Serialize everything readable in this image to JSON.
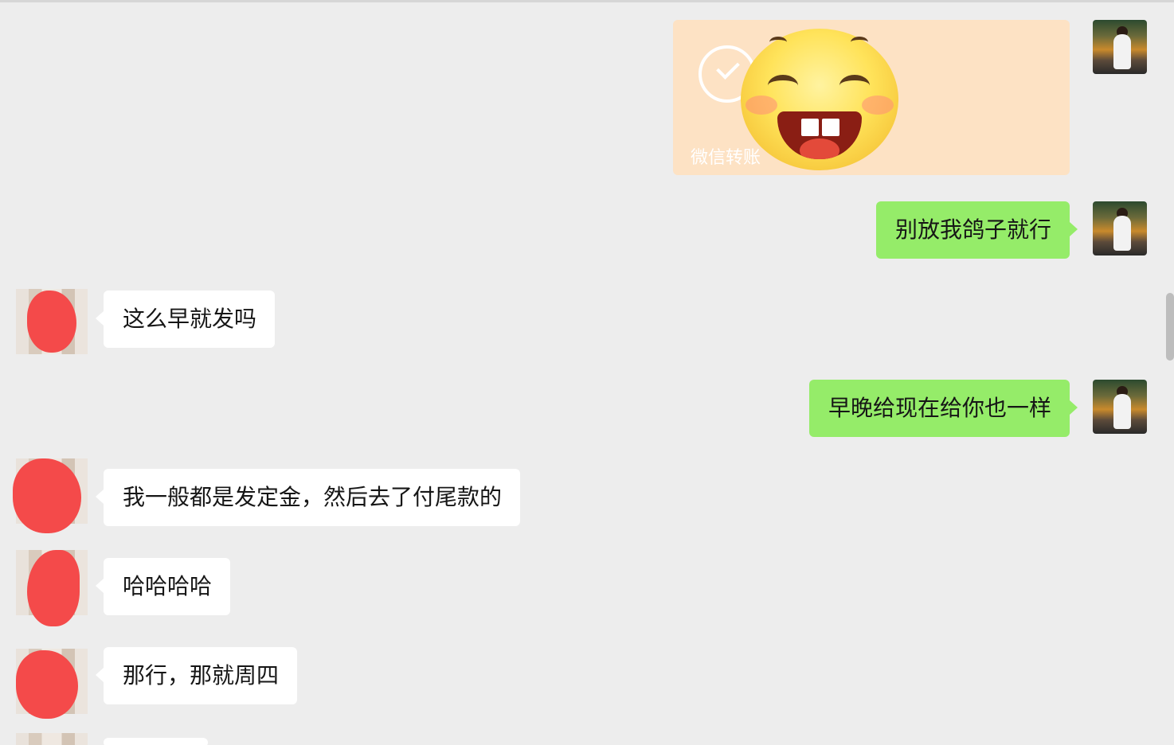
{
  "chat": {
    "transfer_card": {
      "label": "微信转账",
      "sticker": "grinning-emoji-sticker"
    },
    "messages": [
      {
        "sender": "me",
        "text": "别放我鸽子就行"
      },
      {
        "sender": "contact",
        "text": "这么早就发吗"
      },
      {
        "sender": "me",
        "text": "早晚给现在给你也一样"
      },
      {
        "sender": "contact",
        "text": "我一般都是发定金，然后去了付尾款的"
      },
      {
        "sender": "contact",
        "text": "哈哈哈哈"
      },
      {
        "sender": "contact",
        "text": "那行，那就周四"
      }
    ]
  },
  "colors": {
    "background": "#ededed",
    "sent_bubble": "#95ec69",
    "received_bubble": "#ffffff",
    "transfer_card": "#fde2c4",
    "redaction": "#f44a4a"
  }
}
